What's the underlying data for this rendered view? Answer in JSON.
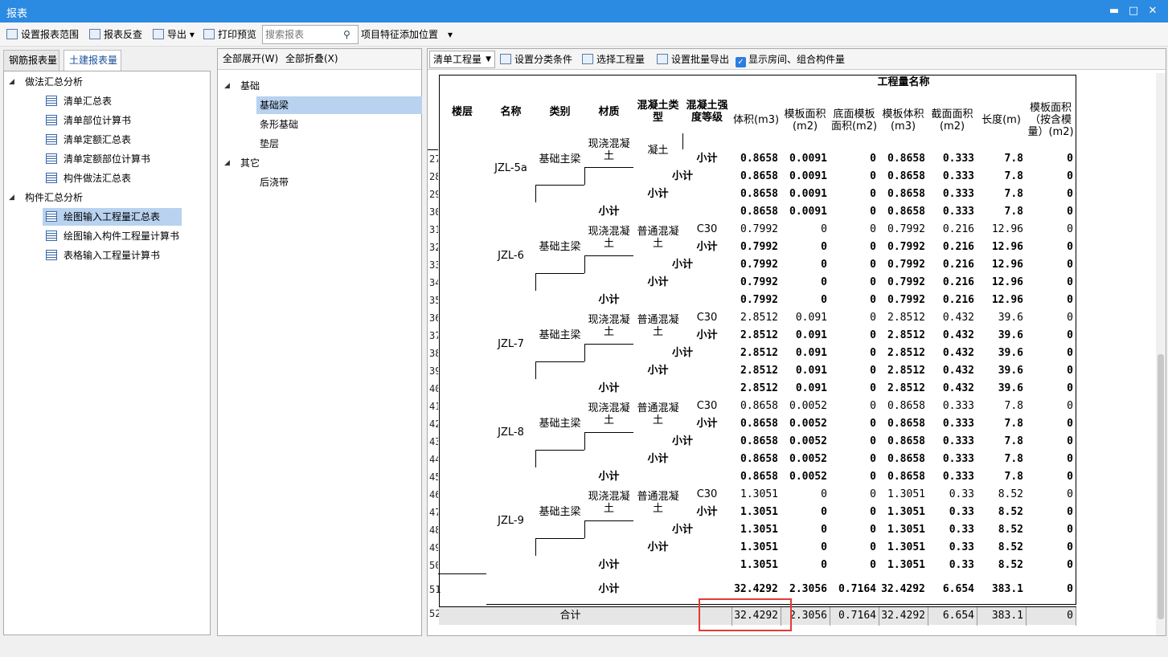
{
  "window": {
    "title": "报表"
  },
  "toolbar": {
    "set_range": "设置报表范围",
    "reverse": "报表反查",
    "export": "导出",
    "print_preview": "打印预览",
    "search_placeholder": "搜索报表",
    "feature_pos": "项目特征添加位置"
  },
  "tabs": [
    "钢筋报表量",
    "土建报表量"
  ],
  "left_tree": [
    {
      "label": "做法汇总分析",
      "level": 0,
      "expanded": true
    },
    {
      "label": "清单汇总表",
      "level": 1
    },
    {
      "label": "清单部位计算书",
      "level": 1
    },
    {
      "label": "清单定额汇总表",
      "level": 1
    },
    {
      "label": "清单定额部位计算书",
      "level": 1
    },
    {
      "label": "构件做法汇总表",
      "level": 1
    },
    {
      "label": "构件汇总分析",
      "level": 0,
      "expanded": true
    },
    {
      "label": "绘图输入工程量汇总表",
      "level": 1,
      "selected": true
    },
    {
      "label": "绘图输入构件工程量计算书",
      "level": 1
    },
    {
      "label": "表格输入工程量计算书",
      "level": 1
    }
  ],
  "middle": {
    "expand_all": "全部展开(W)",
    "collapse_all": "全部折叠(X)",
    "tree": [
      {
        "label": "基础",
        "level": 0
      },
      {
        "label": "基础梁",
        "level": 1,
        "selected": true
      },
      {
        "label": "条形基础",
        "level": 1
      },
      {
        "label": "垫层",
        "level": 1
      },
      {
        "label": "其它",
        "level": 0
      },
      {
        "label": "后浇带",
        "level": 1
      }
    ]
  },
  "report_toolbar": {
    "combo": "清单工程量",
    "set_category": "设置分类条件",
    "select_project": "选择工程量",
    "batch_export": "设置批量导出",
    "show_rooms": "显示房间、组合构件量"
  },
  "table": {
    "header": {
      "group": "工程量名称",
      "floor": "楼层",
      "name": "名称",
      "kind": "类别",
      "material": "材质",
      "concrete_type": "混凝土类型",
      "strength": "混凝土强度等级",
      "cols": [
        "体积(m3)",
        "模板面积(m2)",
        "底面模板面积(m2)",
        "模板体积(m3)",
        "截面面积(m2)",
        "长度(m)",
        "模板面积（按含模量）(m2)"
      ]
    },
    "labels": {
      "subtotal": "小计",
      "total": "合计",
      "foundation_beam": "基础主梁",
      "cast_concrete": "现浇混凝土",
      "normal_concrete": "普通混凝土",
      "normal_concrete_cut": "凝土",
      "cast_concrete_cut": "现浇混凝土",
      "c30": "C30"
    },
    "row_numbers": [
      "27",
      "28",
      "29",
      "30",
      "31",
      "32",
      "33",
      "34",
      "35",
      "36",
      "37",
      "38",
      "39",
      "40",
      "41",
      "42",
      "43",
      "44",
      "45",
      "46",
      "47",
      "48",
      "49",
      "50",
      "51",
      "52"
    ],
    "top_group": {
      "name": "JZL-5a",
      "values": [
        [
          "0.8658",
          "0.0091",
          "0",
          "0.8658",
          "0.333",
          "7.8",
          "0"
        ],
        [
          "0.8658",
          "0.0091",
          "0",
          "0.8658",
          "0.333",
          "7.8",
          "0"
        ],
        [
          "0.8658",
          "0.0091",
          "0",
          "0.8658",
          "0.333",
          "7.8",
          "0"
        ],
        [
          "0.8658",
          "0.0091",
          "0",
          "0.8658",
          "0.333",
          "7.8",
          "0"
        ]
      ]
    },
    "groups": [
      {
        "name": "JZL-6",
        "c30": [
          "0.7992",
          "0",
          "0",
          "0.7992",
          "0.216",
          "12.96",
          "0"
        ],
        "sub": [
          "0.7992",
          "0",
          "0",
          "0.7992",
          "0.216",
          "12.96",
          "0"
        ]
      },
      {
        "name": "JZL-7",
        "c30": [
          "2.8512",
          "0.091",
          "0",
          "2.8512",
          "0.432",
          "39.6",
          "0"
        ],
        "sub": [
          "2.8512",
          "0.091",
          "0",
          "2.8512",
          "0.432",
          "39.6",
          "0"
        ]
      },
      {
        "name": "JZL-8",
        "c30": [
          "0.8658",
          "0.0052",
          "0",
          "0.8658",
          "0.333",
          "7.8",
          "0"
        ],
        "sub": [
          "0.8658",
          "0.0052",
          "0",
          "0.8658",
          "0.333",
          "7.8",
          "0"
        ]
      },
      {
        "name": "JZL-9",
        "c30": [
          "1.3051",
          "0",
          "0",
          "1.3051",
          "0.33",
          "8.52",
          "0"
        ],
        "sub": [
          "1.3051",
          "0",
          "0",
          "1.3051",
          "0.33",
          "8.52",
          "0"
        ]
      }
    ],
    "floor_subtotal": [
      "32.4292",
      "2.3056",
      "0.7164",
      "32.4292",
      "6.654",
      "383.1",
      "0"
    ],
    "total": [
      "32.4292",
      "2.3056",
      "0.7164",
      "32.4292",
      "6.654",
      "383.1",
      "0"
    ]
  }
}
